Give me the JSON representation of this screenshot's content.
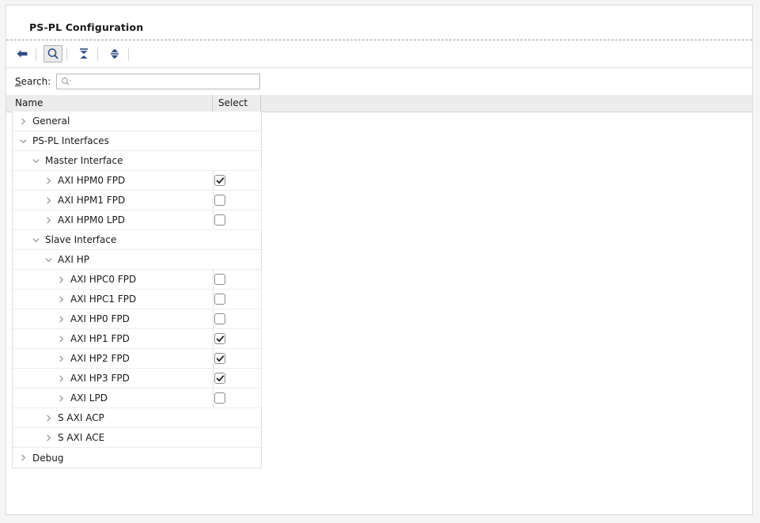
{
  "panel": {
    "title": "PS-PL Configuration"
  },
  "toolbar": {
    "buttons": [
      {
        "name": "back-arrow-icon",
        "label": "Back",
        "icon": "arrow-left-icon",
        "active": false
      },
      {
        "name": "search-toggle-button",
        "label": "Search",
        "icon": "search-icon",
        "active": true
      },
      {
        "name": "collapse-all-button",
        "label": "Collapse All",
        "icon": "collapse-all-icon",
        "active": false
      },
      {
        "name": "expand-all-button",
        "label": "Expand All",
        "icon": "expand-all-icon",
        "active": false
      }
    ]
  },
  "search": {
    "label_mnemonic": "S",
    "label_rest": "earch:",
    "value": "",
    "placeholder": "",
    "icon": "search-dropdown-icon"
  },
  "columns": {
    "name": "Name",
    "select": "Select"
  },
  "colors": {
    "icon_blue": "#2e4d86",
    "header_gray": "#ececec",
    "panel_bg": "#ffffff",
    "window_bg": "#f5f5f5",
    "border": "#dedede"
  },
  "tree": {
    "rows": [
      {
        "label": "General",
        "level": 0,
        "arrow": "collapsed",
        "checkbox": null
      },
      {
        "label": "PS-PL Interfaces",
        "level": 0,
        "arrow": "expanded",
        "checkbox": null
      },
      {
        "label": "Master Interface",
        "level": 1,
        "arrow": "expanded",
        "checkbox": null
      },
      {
        "label": "AXI HPM0 FPD",
        "level": 2,
        "arrow": "collapsed",
        "checkbox": true
      },
      {
        "label": "AXI HPM1 FPD",
        "level": 2,
        "arrow": "collapsed",
        "checkbox": false
      },
      {
        "label": "AXI HPM0 LPD",
        "level": 2,
        "arrow": "collapsed",
        "checkbox": false
      },
      {
        "label": "Slave Interface",
        "level": 1,
        "arrow": "expanded",
        "checkbox": null
      },
      {
        "label": "AXI HP",
        "level": 2,
        "arrow": "expanded",
        "checkbox": null
      },
      {
        "label": "AXI HPC0 FPD",
        "level": 3,
        "arrow": "collapsed",
        "checkbox": false
      },
      {
        "label": "AXI HPC1 FPD",
        "level": 3,
        "arrow": "collapsed",
        "checkbox": false
      },
      {
        "label": "AXI HP0 FPD",
        "level": 3,
        "arrow": "collapsed",
        "checkbox": false
      },
      {
        "label": "AXI HP1 FPD",
        "level": 3,
        "arrow": "collapsed",
        "checkbox": true
      },
      {
        "label": "AXI HP2 FPD",
        "level": 3,
        "arrow": "collapsed",
        "checkbox": true
      },
      {
        "label": "AXI HP3 FPD",
        "level": 3,
        "arrow": "collapsed",
        "checkbox": true
      },
      {
        "label": "AXI LPD",
        "level": 3,
        "arrow": "collapsed",
        "checkbox": false
      },
      {
        "label": "S AXI ACP",
        "level": 2,
        "arrow": "collapsed",
        "checkbox": null
      },
      {
        "label": "S AXI ACE",
        "level": 2,
        "arrow": "collapsed",
        "checkbox": null
      },
      {
        "label": "Debug",
        "level": 0,
        "arrow": "collapsed",
        "checkbox": null
      }
    ]
  }
}
